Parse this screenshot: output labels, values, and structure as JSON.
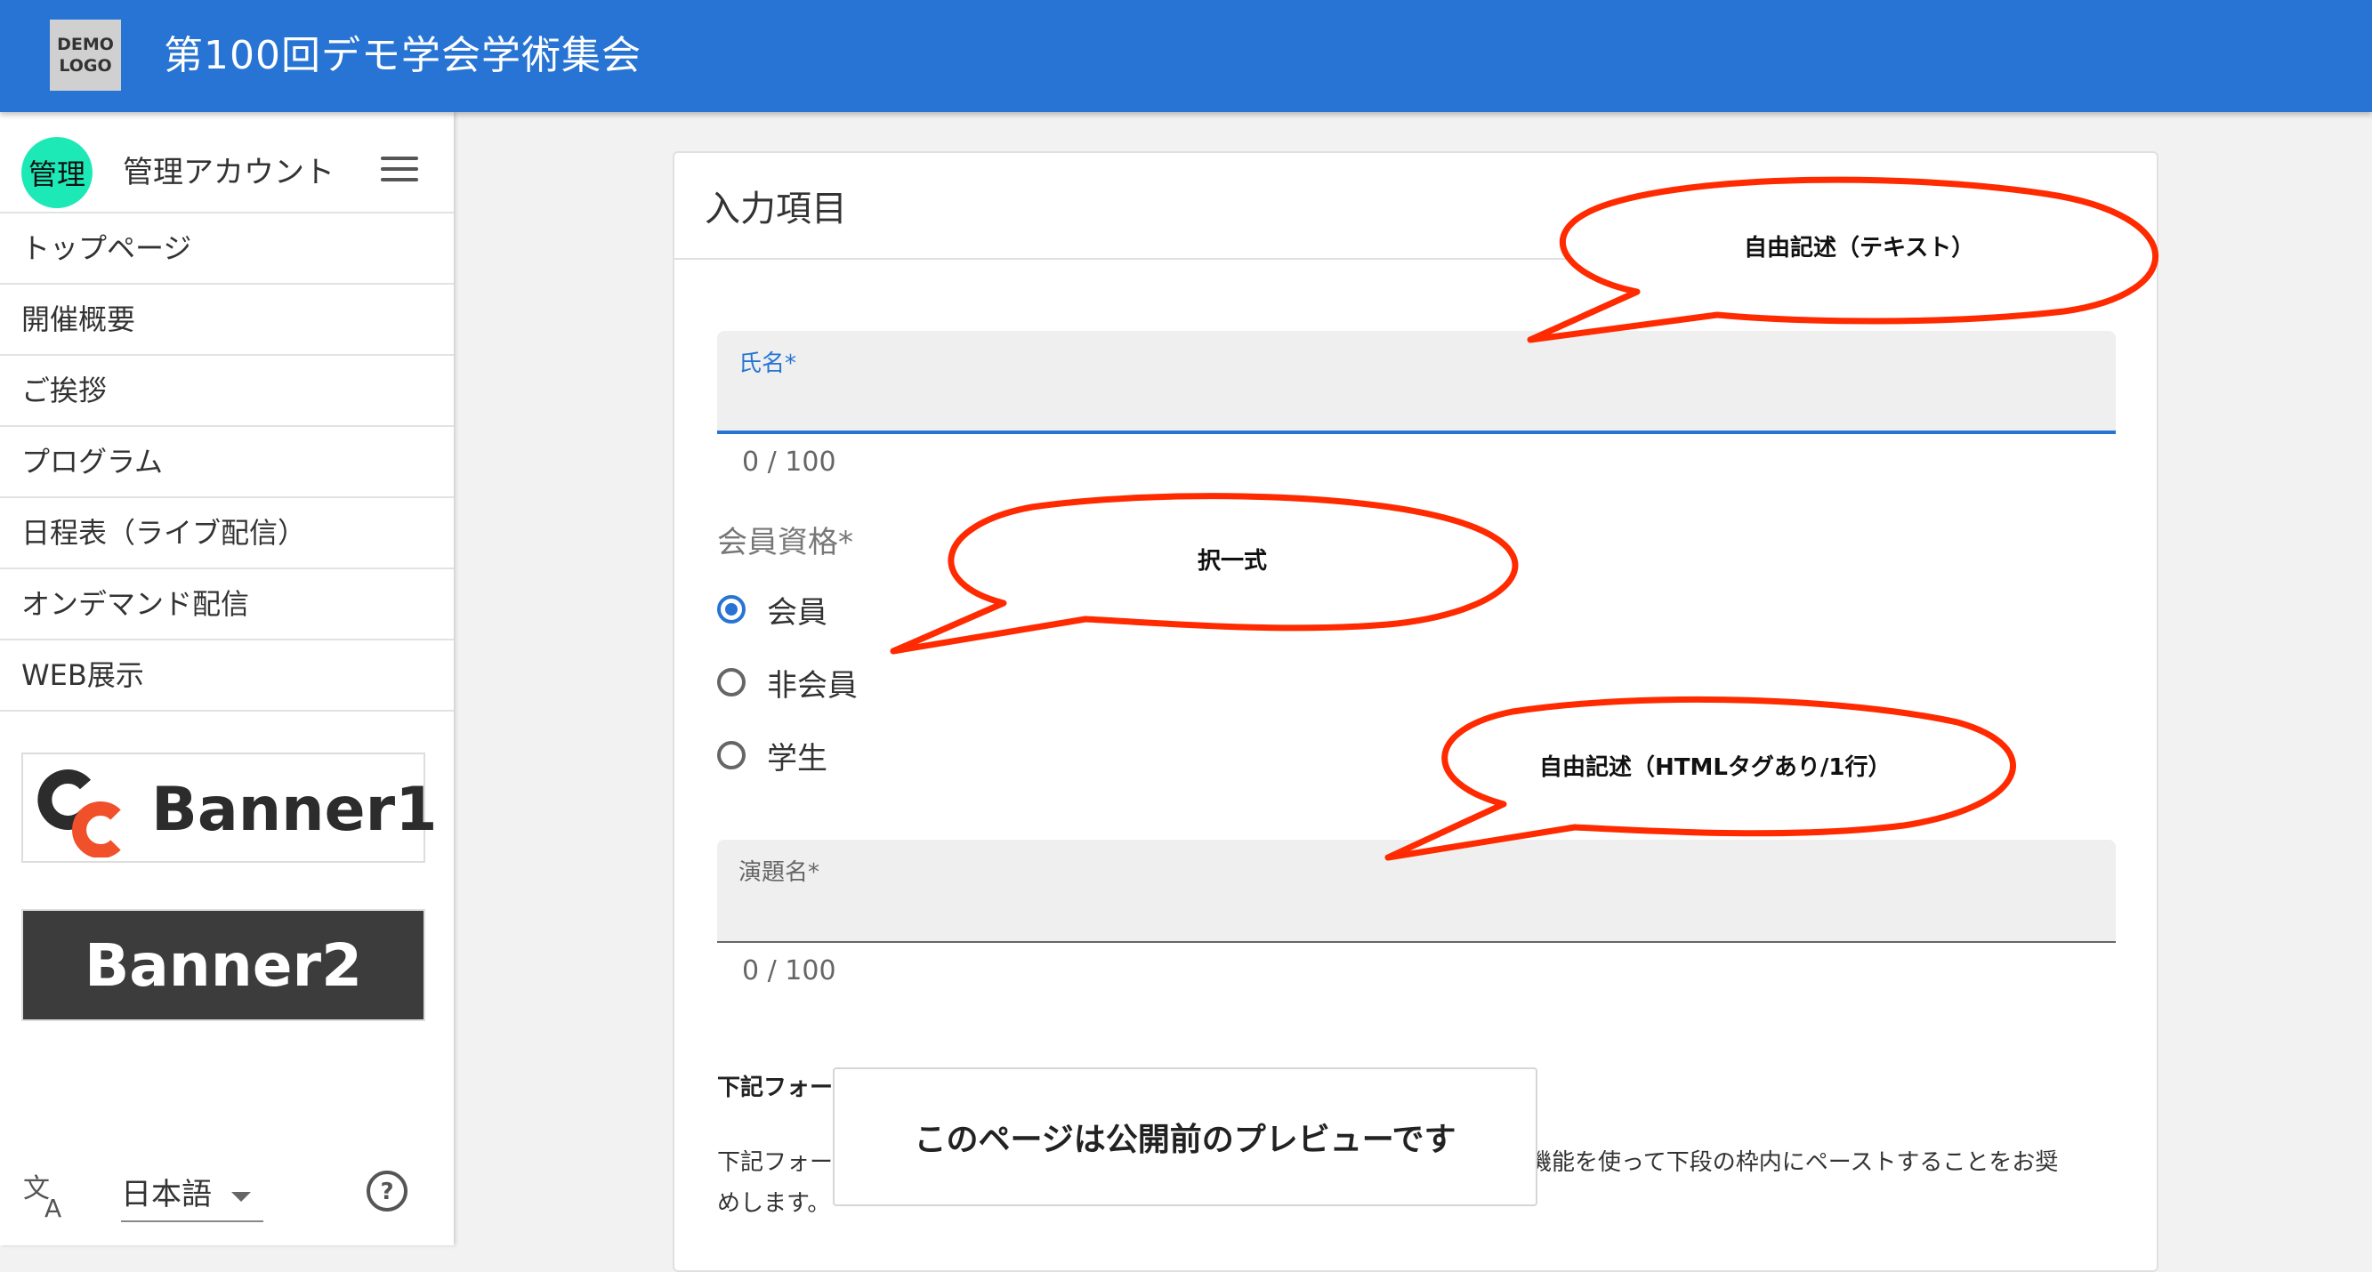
{
  "header": {
    "logo_line1": "DEMO",
    "logo_line2": "LOGO",
    "title": "第100回デモ学会学術集会",
    "color": "#2774d4"
  },
  "sidebar": {
    "avatar_text": "管理",
    "account_name": "管理アカウント",
    "items": [
      {
        "label": "トップページ"
      },
      {
        "label": "開催概要"
      },
      {
        "label": "ご挨拶"
      },
      {
        "label": "プログラム"
      },
      {
        "label": "日程表（ライブ配信）"
      },
      {
        "label": "オンデマンド配信"
      },
      {
        "label": "WEB展示"
      }
    ],
    "banner1_text": "Banner1",
    "banner2_text": "Banner2",
    "language": "日本語"
  },
  "form": {
    "card_title": "入力項目",
    "name_label": "氏名*",
    "name_counter": "0 / 100",
    "membership_label": "会員資格*",
    "membership_options": [
      {
        "label": "会員",
        "checked": true
      },
      {
        "label": "非会員",
        "checked": false
      },
      {
        "label": "学生",
        "checked": false
      }
    ],
    "title_label": "演題名*",
    "title_counter": "0 / 100",
    "section_heading": "下記フォー",
    "desc_part1": "下記フォー",
    "desc_part2": "機能を使って下段の枠内にペーストすることをお奨",
    "desc_part3": "めします。"
  },
  "preview_notice": "このページは公開前のプレビューです",
  "annotations": {
    "callout_free_text": "自由記述（テキスト）",
    "callout_choice": "択一式",
    "callout_html": "自由記述（HTMLタグあり/1行）",
    "color": "#ff2a00"
  }
}
